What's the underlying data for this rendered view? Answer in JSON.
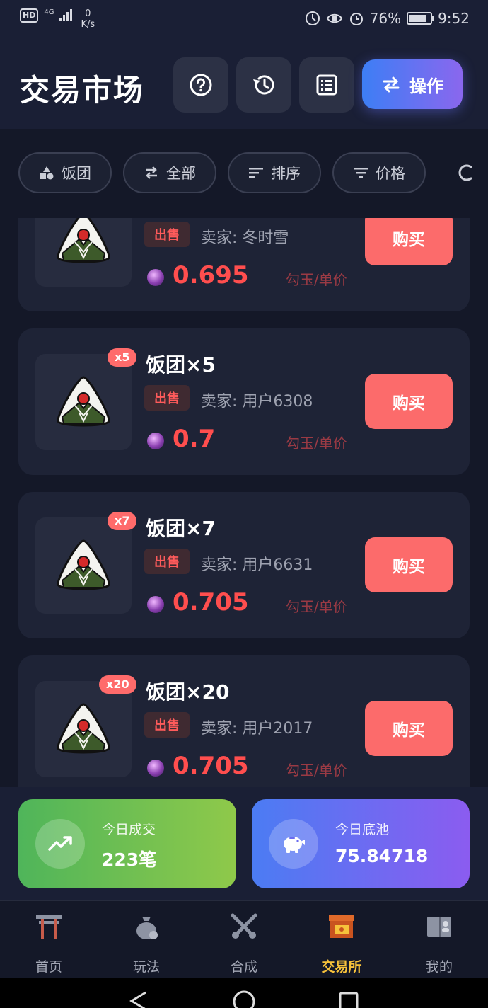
{
  "status_bar": {
    "hd": "HD",
    "network": "4G",
    "speed_value": "0",
    "speed_unit": "K/s",
    "battery_level": 0.76,
    "battery": "76%",
    "time": "9:52",
    "icons": [
      "data-saver-icon",
      "eye-icon",
      "alarm-icon",
      "battery-icon"
    ]
  },
  "header": {
    "title": "交易市场",
    "help_icon": "question-circle-icon",
    "history_icon": "history-icon",
    "list_icon": "list-icon",
    "operate_label": "操作",
    "operate_icon": "swap-arrows-icon"
  },
  "filters": [
    {
      "label": "饭团",
      "icon": "shapes-icon"
    },
    {
      "label": "全部",
      "icon": "swap-arrows-icon"
    },
    {
      "label": "排序",
      "icon": "sort-icon"
    },
    {
      "label": "价格",
      "icon": "filter-icon"
    }
  ],
  "listings": [
    {
      "name": "",
      "qty": "",
      "tag": "出售",
      "seller": "卖家: 冬时雪",
      "price": "0.695",
      "unit": "勾玉/单价",
      "buy": "购买"
    },
    {
      "name": "饭团×5",
      "qty": "x5",
      "tag": "出售",
      "seller": "卖家: 用户6308",
      "price": "0.7",
      "unit": "勾玉/单价",
      "buy": "购买"
    },
    {
      "name": "饭团×7",
      "qty": "x7",
      "tag": "出售",
      "seller": "卖家: 用户6631",
      "price": "0.705",
      "unit": "勾玉/单价",
      "buy": "购买"
    },
    {
      "name": "饭团×20",
      "qty": "x20",
      "tag": "出售",
      "seller": "卖家: 用户2017",
      "price": "0.705",
      "unit": "勾玉/单价",
      "buy": "购买"
    }
  ],
  "stats": {
    "today_deals": {
      "label": "今日成交",
      "value": "223笔",
      "icon": "trend-up-icon",
      "color": "#6dbf4b"
    },
    "today_pool": {
      "label": "今日底池",
      "value": "75.84718",
      "icon": "piggy-bank-icon",
      "color": "#5f6ff2"
    }
  },
  "bottom_nav": [
    {
      "label": "首页",
      "icon": "torii-gate-icon",
      "active": false
    },
    {
      "label": "玩法",
      "icon": "money-bag-icon",
      "active": false
    },
    {
      "label": "合成",
      "icon": "crossed-swords-icon",
      "active": false
    },
    {
      "label": "交易所",
      "icon": "market-stall-icon",
      "active": true
    },
    {
      "label": "我的",
      "icon": "profile-book-icon",
      "active": false
    }
  ],
  "colors": {
    "accent_red": "#ff4e4e",
    "buy_button": "#fc6b6b",
    "active_nav": "#f7c23b",
    "background": "#141828"
  }
}
